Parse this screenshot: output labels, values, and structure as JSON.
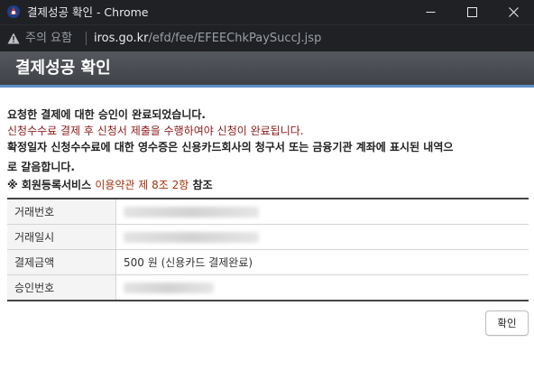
{
  "window": {
    "title": "결제성공 확인 - Chrome",
    "controls": {
      "minimize": "minimize-icon",
      "maximize": "maximize-icon",
      "close": "close-icon"
    }
  },
  "address_bar": {
    "security_warning": "주의 요함",
    "url_host": "iros.go.kr",
    "url_path": "/efd/fee/EFEEChkPaySuccJ.jsp"
  },
  "page": {
    "header_title": "결제성공 확인",
    "messages": {
      "line1": "요청한 결제에 대한 승인이 완료되었습니다.",
      "line2": "신청수수료 결제 후 신청서 제출을 수행하여야 신청이 완료됩니다.",
      "line3": "확정일자 신청수수료에 대한 영수증은 신용카드회사의 청구서 또는 금융기관 계좌에 표시된 내역으",
      "line4": "로 갈음합니다.",
      "notice_prefix": "※ 회원등록서비스",
      "notice_link": "이용약관 제 8조 2항",
      "notice_suffix": "참조"
    },
    "table": {
      "rows": [
        {
          "label": "거래번호",
          "value": "",
          "redacted": true
        },
        {
          "label": "거래일시",
          "value": "",
          "redacted": true
        },
        {
          "label": "결제금액",
          "value": "500 원 (신용카드 결제완료)",
          "redacted": false
        },
        {
          "label": "승인번호",
          "value": "",
          "redacted": true
        }
      ]
    },
    "confirm_button": "확인"
  },
  "colors": {
    "titlebar_bg": "#202124",
    "header_bg": "#4a4d52",
    "accent_line": "#5b8fc9",
    "notice_red": "#8b1a1a"
  }
}
